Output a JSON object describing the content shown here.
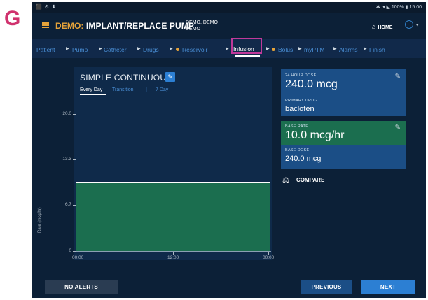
{
  "figure_letter": "G",
  "status_bar": {
    "left_icons": "⬛ ⚙ ⬇",
    "right_text": "✱ ▼◣ 100% ▮ 15:00"
  },
  "app_bar": {
    "title_prefix": "DEMO:",
    "title_main": " IMPLANT/REPLACE PUMP",
    "patient_line1": "DEMO, DEMO",
    "patient_line2": "DEMO",
    "home_label": "HOME",
    "icons": [
      "menu-icon",
      "home-icon",
      "settings-icon"
    ]
  },
  "breadcrumb": {
    "items": [
      {
        "label": "Patient",
        "warn": false
      },
      {
        "label": "Pump",
        "warn": false
      },
      {
        "label": "Catheter",
        "warn": false
      },
      {
        "label": "Drugs",
        "warn": false
      },
      {
        "label": "Reservoir",
        "warn": true
      },
      {
        "label": "Infusion",
        "warn": false,
        "active": true
      },
      {
        "label": "Bolus",
        "warn": true
      },
      {
        "label": "myPTM",
        "warn": false
      },
      {
        "label": "Alarms",
        "warn": false
      },
      {
        "label": "Finish",
        "warn": false
      }
    ]
  },
  "chart_panel": {
    "title": "SIMPLE CONTINUOUS",
    "subtabs": {
      "everyday": "Every Day",
      "transition": "Transition",
      "separator": "|",
      "sevenday": "7 Day"
    }
  },
  "chart_data": {
    "type": "area",
    "title": "SIMPLE CONTINUOUS",
    "ylabel": "Rate (mcg/hr)",
    "xlabel": "",
    "x_ticks": [
      "00:00",
      "12:00",
      "00:00"
    ],
    "y_ticks": [
      0,
      6.7,
      13.3,
      20.0
    ],
    "y_tick_labels": [
      "0",
      "6.7",
      "13.3",
      "20.0"
    ],
    "ylim": [
      0,
      22
    ],
    "x_hours": [
      0,
      24
    ],
    "series": [
      {
        "values": [
          10.0,
          10.0
        ]
      }
    ],
    "grid": false,
    "fill_color": "#1b6e4f"
  },
  "cards": {
    "dose_24h_label": "24 HOUR DOSE",
    "dose_24h_value": "240.0 mcg",
    "primary_drug_label": "PRIMARY DRUG",
    "primary_drug_value": "baclofen",
    "base_rate_label": "BASE RATE",
    "base_rate_value": "10.0 mcg/hr",
    "base_dose_label": "BASE DOSE",
    "base_dose_value": "240.0 mcg"
  },
  "compare_label": "COMPARE",
  "footer": {
    "no_alerts": "NO ALERTS",
    "previous": "PREVIOUS",
    "next": "NEXT"
  },
  "colors": {
    "accent_orange": "#e6a33a",
    "active_highlight": "#c0399a",
    "card_blue": "#1b4e86",
    "card_green": "#1b6e4f",
    "figure_letter": "#d0326e"
  }
}
